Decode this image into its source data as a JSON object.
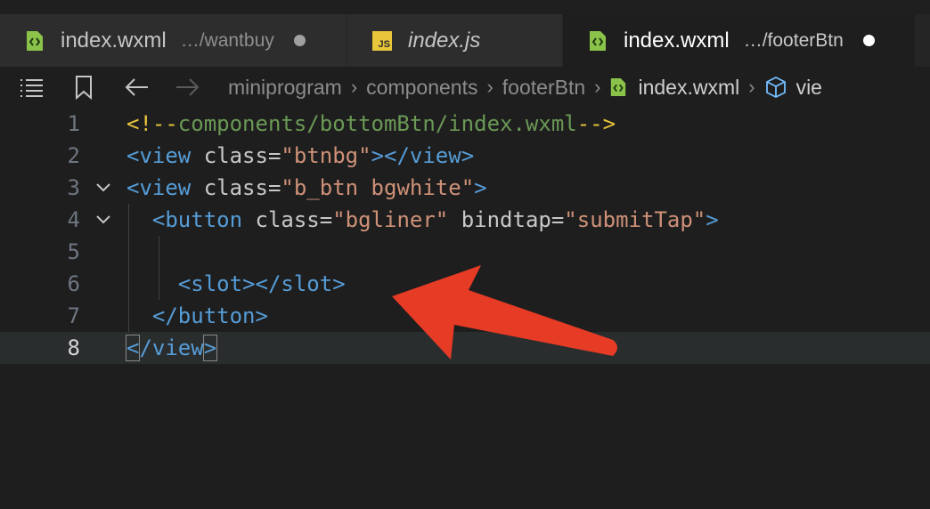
{
  "tabs": [
    {
      "file": "index.wxml",
      "path": "…/wantbuy",
      "icon": "wxml-file-icon",
      "active": false
    },
    {
      "file": "index.js",
      "icon": "js-file-icon",
      "badge": "JS",
      "active": false
    },
    {
      "file": "index.wxml",
      "path": "…/footerBtn",
      "icon": "wxml-file-icon",
      "active": true
    }
  ],
  "breadcrumb": {
    "items": [
      "miniprogram",
      "components",
      "footerBtn"
    ],
    "file": "index.wxml",
    "symbol": "vie"
  },
  "code": {
    "lines": [
      {
        "num": "1",
        "parts": [
          [
            "c-comment",
            "<!--"
          ],
          [
            "c-comment-body",
            "components/bottomBtn/index.wxml"
          ],
          [
            "c-comment",
            "-->"
          ]
        ]
      },
      {
        "num": "2",
        "parts": [
          [
            "c-tag",
            "<view "
          ],
          [
            "c-attr",
            "class"
          ],
          [
            "c-attr",
            "="
          ],
          [
            "c-str",
            "\"btnbg\""
          ],
          [
            "c-tag",
            "></view>"
          ]
        ]
      },
      {
        "num": "3",
        "fold": true,
        "parts": [
          [
            "c-tag",
            "<view "
          ],
          [
            "c-attr",
            "class"
          ],
          [
            "c-attr",
            "="
          ],
          [
            "c-str",
            "\"b_btn bgwhite\""
          ],
          [
            "c-tag",
            ">"
          ]
        ]
      },
      {
        "num": "4",
        "fold": true,
        "parts": [
          [
            "",
            "  "
          ],
          [
            "c-tag",
            "<button "
          ],
          [
            "c-attr",
            "class"
          ],
          [
            "c-attr",
            "="
          ],
          [
            "c-str",
            "\"bgliner\""
          ],
          [
            "c-attr",
            " bindtap"
          ],
          [
            "c-attr",
            "="
          ],
          [
            "c-str",
            "\"submitTap\""
          ],
          [
            "c-tag",
            ">"
          ]
        ]
      },
      {
        "num": "5",
        "parts": [
          [
            "",
            ""
          ]
        ]
      },
      {
        "num": "6",
        "parts": [
          [
            "",
            "    "
          ],
          [
            "c-tag",
            "<slot></slot>"
          ]
        ]
      },
      {
        "num": "7",
        "parts": [
          [
            "",
            "  "
          ],
          [
            "c-tag",
            "</button>"
          ]
        ]
      },
      {
        "num": "8",
        "current": true,
        "parts": [
          [
            "c-tag bracket-box",
            "<"
          ],
          [
            "c-tag",
            "/view"
          ],
          [
            "c-tag bracket-box",
            ">"
          ]
        ]
      }
    ]
  },
  "colors": {
    "background": "#1e1e1e",
    "tag": "#569cd6",
    "string": "#ce9178",
    "comment_delim": "#e8c33d",
    "comment_text": "#6a9955",
    "annotation_arrow": "#e63b25"
  }
}
